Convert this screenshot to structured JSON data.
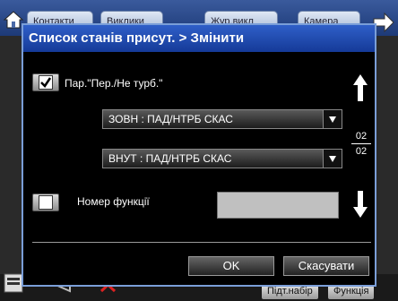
{
  "background": {
    "tabs": [
      "Контакти",
      "Виклики",
      "Жур.викл",
      "Камера"
    ],
    "bottom_buttons": [
      "Підт.набір",
      "Функція"
    ]
  },
  "dialog": {
    "title": "Список станів присут. > Змінити",
    "option1": {
      "label": "Пар.\"Пер./Не турб.\"",
      "checked": true,
      "select_outer": "ЗОВН : ПАД/НТРБ СКАС",
      "select_inner": "ВНУТ : ПАД/НТРБ СКАС"
    },
    "option2": {
      "label": "Номер функції",
      "checked": false,
      "value": ""
    },
    "page": {
      "current": "02",
      "total": "02"
    },
    "ok_label": "OK",
    "cancel_label": "Скасувати"
  }
}
